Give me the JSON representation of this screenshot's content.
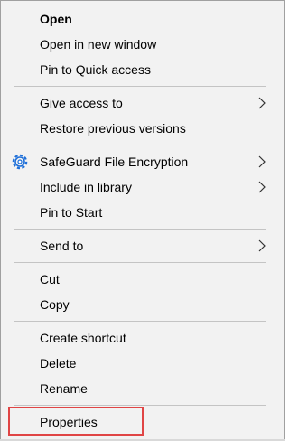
{
  "context_menu": {
    "items": [
      {
        "id": "open",
        "label": "Open"
      },
      {
        "id": "open-new-window",
        "label": "Open in new window"
      },
      {
        "id": "pin-quick-access",
        "label": "Pin to Quick access"
      },
      {
        "id": "give-access",
        "label": "Give access to"
      },
      {
        "id": "restore-previous",
        "label": "Restore previous versions"
      },
      {
        "id": "safeguard",
        "label": "SafeGuard File Encryption",
        "icon": "safeguard-gear-icon"
      },
      {
        "id": "include-library",
        "label": "Include in library"
      },
      {
        "id": "pin-start",
        "label": "Pin to Start"
      },
      {
        "id": "send-to",
        "label": "Send to"
      },
      {
        "id": "cut",
        "label": "Cut"
      },
      {
        "id": "copy",
        "label": "Copy"
      },
      {
        "id": "create-shortcut",
        "label": "Create shortcut"
      },
      {
        "id": "delete",
        "label": "Delete"
      },
      {
        "id": "rename",
        "label": "Rename"
      },
      {
        "id": "properties",
        "label": "Properties",
        "highlighted": true
      }
    ]
  },
  "colors": {
    "menu_bg": "#f2f2f2",
    "text": "#000000",
    "highlight_border": "#e04545",
    "icon_blue": "#1e6fd9"
  }
}
